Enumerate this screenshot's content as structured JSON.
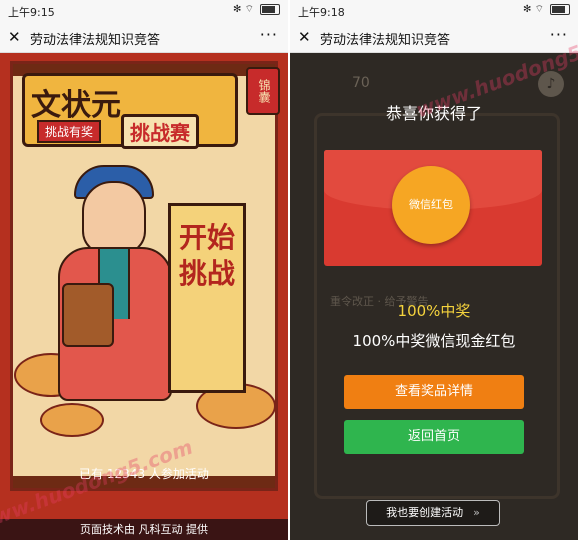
{
  "left": {
    "status": {
      "time": "上午9:15",
      "icons": "✻ ⌔"
    },
    "nav": {
      "title": "劳动法律法规知识竞答",
      "close": "✕",
      "more": "···"
    },
    "poster": {
      "title_main": "文状元",
      "title_tag": "挑战有奖",
      "title_challenge": "挑战赛",
      "bag_label": "锦囊",
      "start_button": "开始挑战",
      "participants": "已有 12343 人参加活动",
      "footer": "页面技术由 凡科互动 提供"
    }
  },
  "right": {
    "status": {
      "time": "上午9:18",
      "icons": "✻ ⌔"
    },
    "nav": {
      "title": "劳动法律法规知识竞答",
      "close": "✕",
      "more": "···"
    },
    "background": {
      "score": "70",
      "music_icon": "♪",
      "option1": "重令改正 · 给予警告"
    },
    "dialog": {
      "congrats": "恭喜你获得了",
      "coin_label": "微信红包",
      "rate": "100%中奖",
      "prize": "100%中奖微信现金红包",
      "details_button": "查看奖品详情",
      "home_button": "返回首页",
      "create_button": "我也要创建活动",
      "create_chevron": "»"
    }
  },
  "watermark": "www.huodong5.com",
  "colors": {
    "orange": "#f07f12",
    "green": "#2fb54e",
    "red": "#d93a30",
    "gold": "#f6a623"
  }
}
